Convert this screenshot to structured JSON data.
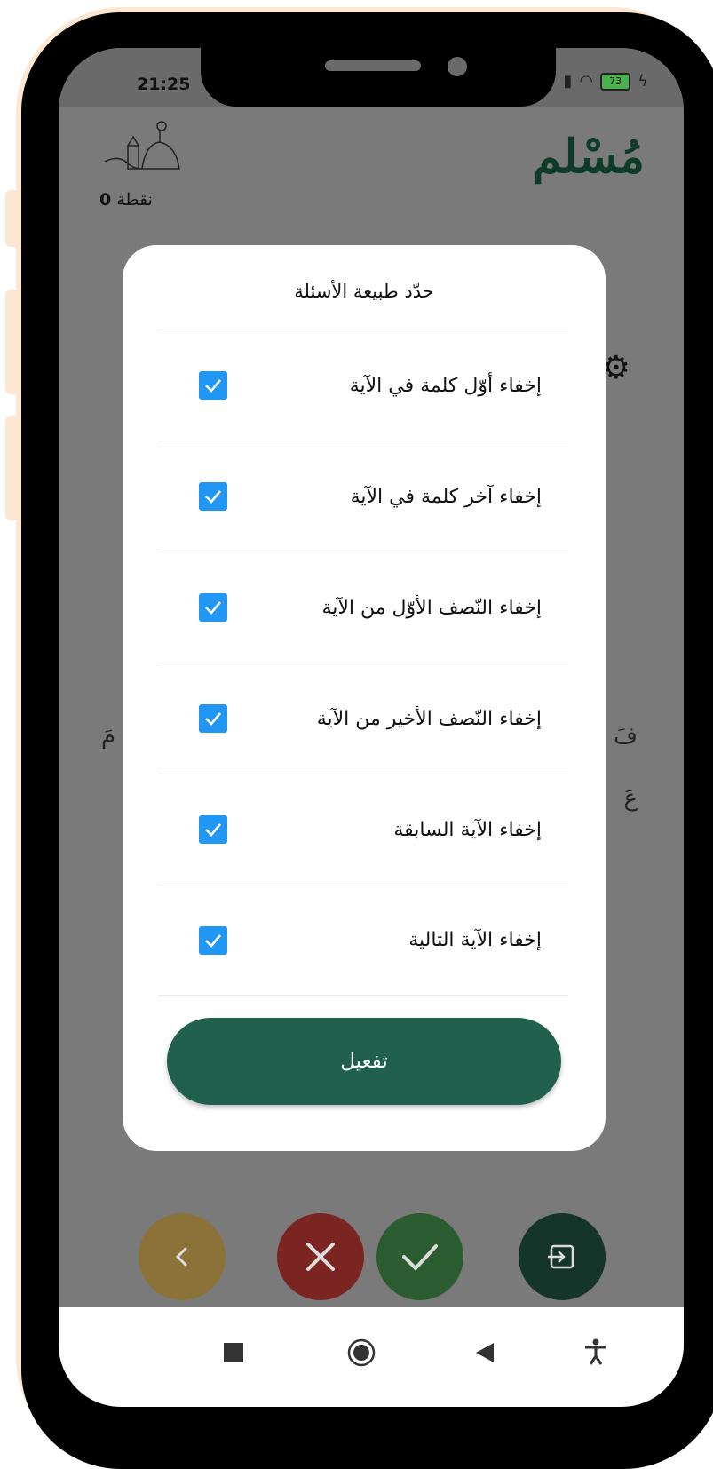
{
  "status_bar": {
    "time": "21:25",
    "battery": "73"
  },
  "header": {
    "app_title": "مُسْلم",
    "points_value": "0",
    "points_label": "نقطة"
  },
  "background_text": {
    "peek_left": "مَ",
    "peek_right": "فَ",
    "peek_right2": "عَ"
  },
  "dialog": {
    "title": "حدّد طبيعة الأسئلة",
    "options": [
      {
        "label": "إخفاء أوّل كلمة في الآية",
        "checked": true
      },
      {
        "label": "إخفاء آخر كلمة في الآية",
        "checked": true
      },
      {
        "label": "إخفاء النّصف الأوّل من الآية",
        "checked": true
      },
      {
        "label": "إخفاء النّصف الأخير  من الآية",
        "checked": true
      },
      {
        "label": "إخفاء الآية السابقة",
        "checked": true
      },
      {
        "label": "إخفاء الآية التالية",
        "checked": true
      }
    ],
    "activate_label": "تفعيل"
  },
  "actions": [
    "chevron-left-icon",
    "close-icon",
    "check-icon",
    "exit-icon"
  ],
  "nav": [
    "recents-icon",
    "home-icon",
    "back-icon",
    "accessibility-icon"
  ],
  "colors": {
    "primary": "#22604e",
    "checkbox": "#2196f3",
    "title": "#0d3a29"
  }
}
